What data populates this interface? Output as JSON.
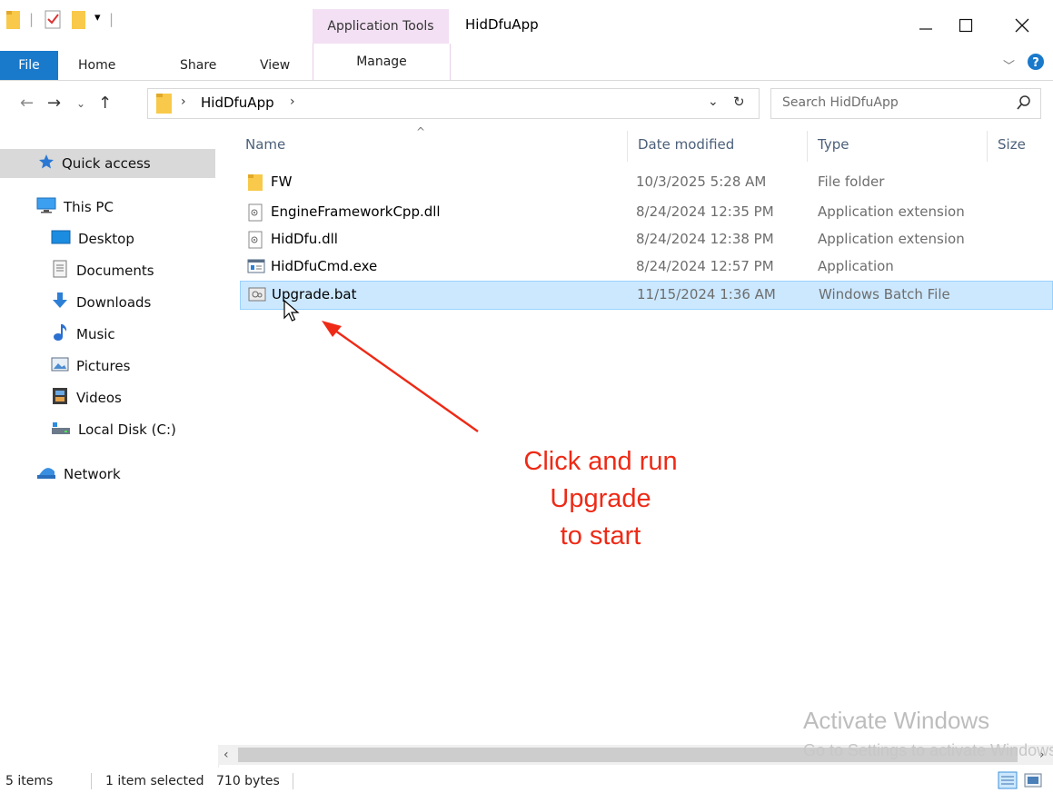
{
  "window": {
    "title": "HidDfuApp",
    "contextual_tab_group": "Application Tools"
  },
  "ribbon": {
    "tabs": [
      "File",
      "Home",
      "Share",
      "View",
      "Manage"
    ]
  },
  "address": {
    "path_segment": "HidDfuApp",
    "search_placeholder": "Search HidDfuApp"
  },
  "nav": {
    "items": [
      {
        "label": "Quick access",
        "icon": "star-icon",
        "selected": true
      },
      {
        "label": "This PC",
        "icon": "computer-icon"
      },
      {
        "label": "Desktop",
        "icon": "desktop-icon"
      },
      {
        "label": "Documents",
        "icon": "documents-icon"
      },
      {
        "label": "Downloads",
        "icon": "download-arrow-icon"
      },
      {
        "label": "Music",
        "icon": "music-note-icon"
      },
      {
        "label": "Pictures",
        "icon": "pictures-icon"
      },
      {
        "label": "Videos",
        "icon": "videos-icon"
      },
      {
        "label": "Local Disk (C:)",
        "icon": "drive-icon"
      },
      {
        "label": "Network",
        "icon": "network-icon"
      }
    ]
  },
  "columns": [
    "Name",
    "Date modified",
    "Type",
    "Size"
  ],
  "files": [
    {
      "name": "FW",
      "date": "10/3/2025 5:28 AM",
      "type": "File folder",
      "icon": "folder-icon"
    },
    {
      "name": "EngineFrameworkCpp.dll",
      "date": "8/24/2024 12:35 PM",
      "type": "Application extension",
      "icon": "dll-file-icon"
    },
    {
      "name": "HidDfu.dll",
      "date": "8/24/2024 12:38 PM",
      "type": "Application extension",
      "icon": "dll-file-icon"
    },
    {
      "name": "HidDfuCmd.exe",
      "date": "8/24/2024 12:57 PM",
      "type": "Application",
      "icon": "exe-file-icon"
    },
    {
      "name": "Upgrade.bat",
      "date": "11/15/2024 1:36 AM",
      "type": "Windows Batch File",
      "icon": "bat-file-icon",
      "selected": true
    }
  ],
  "status": {
    "items_count": "5 items",
    "selection": "1 item selected",
    "size": "710 bytes"
  },
  "annotation": {
    "line1": "Click and run",
    "line2": "Upgrade",
    "line3": "to start",
    "color": "#ee2a16"
  },
  "watermark": {
    "line1": "Activate Windows",
    "line2": "Go to Settings to activate Windows."
  },
  "colors": {
    "file_tab": "#1979ca",
    "selection": "#cce8ff",
    "contextual_tab": "#f3e0f4"
  }
}
